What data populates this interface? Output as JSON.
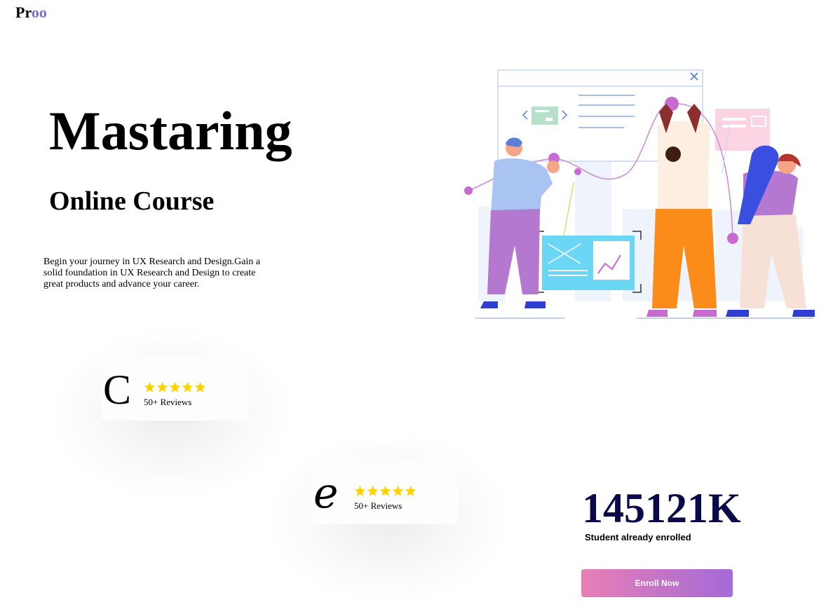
{
  "logo": {
    "prefix": "Pr",
    "accent": "oo"
  },
  "hero": {
    "title": "Mastaring",
    "subtitle": "Online Course",
    "description": "Begin your journey in UX Research and Design.Gain a solid foundation in UX Research and Design to create great products and advance your career."
  },
  "illustration": {
    "icon": "team-analytics-illustration"
  },
  "reviews": [
    {
      "letter": "C",
      "rating": 5,
      "label": "50+ Reviews"
    },
    {
      "letter": "e",
      "rating": 5,
      "label": "50+ Reviews"
    }
  ],
  "stats": {
    "number": "145121K",
    "label": "Student already enrolled"
  },
  "cta": {
    "label": "Enroll Now"
  },
  "colors": {
    "accent": "#7d6fd0",
    "star": "#ffd200",
    "stat": "#0a0a4a",
    "button_from": "#e87fb6",
    "button_to": "#a46ad6"
  }
}
